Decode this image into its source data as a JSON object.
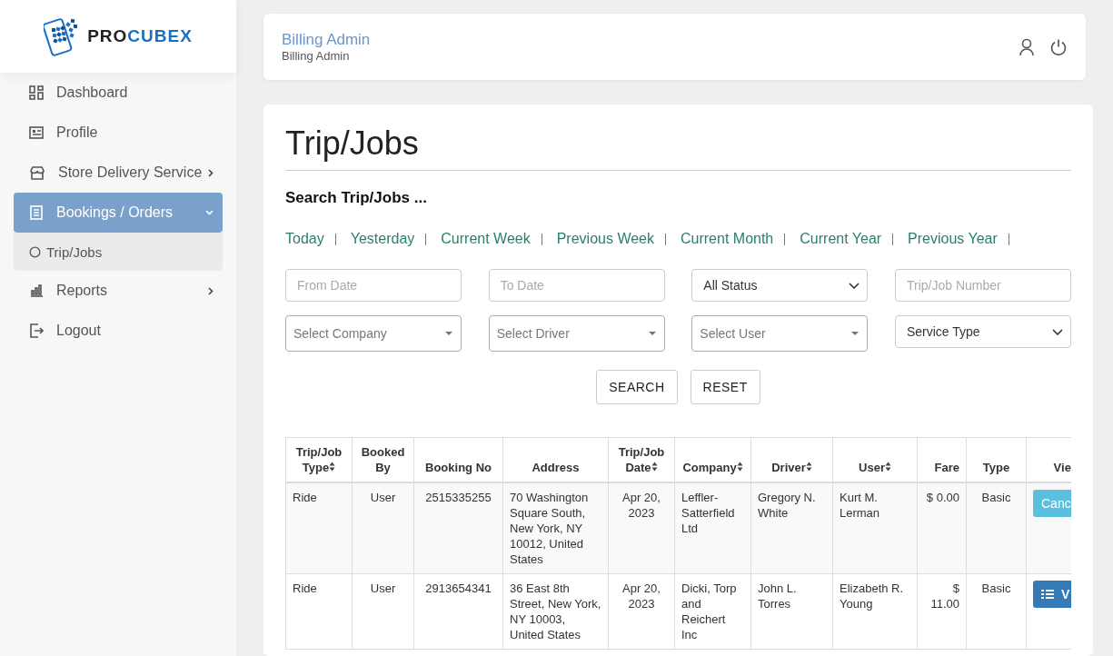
{
  "logo": {
    "text_dark": "PRO",
    "text_accent": "CUBEX"
  },
  "header": {
    "title": "Billing Admin",
    "subtitle": "Billing Admin"
  },
  "sidebar": {
    "items": [
      {
        "label": "Dashboard",
        "kind": "dashboard",
        "selected": false
      },
      {
        "label": "Profile",
        "kind": "profile",
        "selected": false
      },
      {
        "label": "Store Delivery Service",
        "kind": "store",
        "selected": false,
        "expanded": false
      },
      {
        "label": "Bookings / Orders",
        "kind": "bookings",
        "selected": true,
        "expanded": true,
        "children": [
          {
            "label": "Trip/Jobs",
            "selected": true
          }
        ]
      },
      {
        "label": "Reports",
        "kind": "reports",
        "selected": false,
        "expanded": false
      },
      {
        "label": "Logout",
        "kind": "logout",
        "selected": false
      }
    ]
  },
  "page": {
    "title": "Trip/Jobs",
    "search_heading": "Search Trip/Jobs ...",
    "quick_ranges": [
      "Today",
      "Yesterday",
      "Current Week",
      "Previous Week",
      "Current Month",
      "Current Year",
      "Previous Year"
    ],
    "fields": [
      {
        "kind": "input",
        "placeholder": "From Date"
      },
      {
        "kind": "input",
        "placeholder": "To Date"
      },
      {
        "kind": "select",
        "value": "All Status"
      },
      {
        "kind": "input",
        "placeholder": "Trip/Job Number"
      },
      {
        "kind": "combo",
        "placeholder": "Select Company"
      },
      {
        "kind": "combo",
        "placeholder": "Select Driver"
      },
      {
        "kind": "combo",
        "placeholder": "Select User"
      },
      {
        "kind": "select",
        "value": "Service Type"
      }
    ],
    "buttons": [
      "SEARCH",
      "RESET"
    ]
  },
  "table": {
    "columns": [
      {
        "label": "Trip/Job Type",
        "sortable": true
      },
      {
        "label": "Booked By",
        "sortable": false
      },
      {
        "label": "Booking No",
        "sortable": false
      },
      {
        "label": "Address",
        "sortable": false
      },
      {
        "label": "Trip/Job Date",
        "sortable": true
      },
      {
        "label": "Company",
        "sortable": true
      },
      {
        "label": "Driver",
        "sortable": true
      },
      {
        "label": "User",
        "sortable": true
      },
      {
        "label": "Fare",
        "sortable": false
      },
      {
        "label": "Type",
        "sortable": false
      },
      {
        "label": "Vie",
        "sortable": false
      }
    ],
    "rows": [
      {
        "cells": [
          "Ride",
          "User",
          "2515335255",
          "70 Washington Square South, New York, NY 10012, United States",
          "Apr 20, 2023",
          "Leffler-Satterfield Ltd",
          "Gregory N. White",
          "Kurt M. Lerman",
          "$ 0.00",
          "Basic"
        ],
        "action": {
          "kind": "cancel",
          "label": "Canc"
        }
      },
      {
        "cells": [
          "Ride",
          "User",
          "2913654341",
          "36 East 8th Street, New York, NY 10003, United States",
          "Apr 20, 2023",
          "Dicki, Torp and Reichert Inc",
          "John L. Torres",
          "Elizabeth R. Young",
          "$ 11.00",
          "Basic"
        ],
        "action": {
          "kind": "view",
          "label": "V"
        }
      }
    ]
  }
}
